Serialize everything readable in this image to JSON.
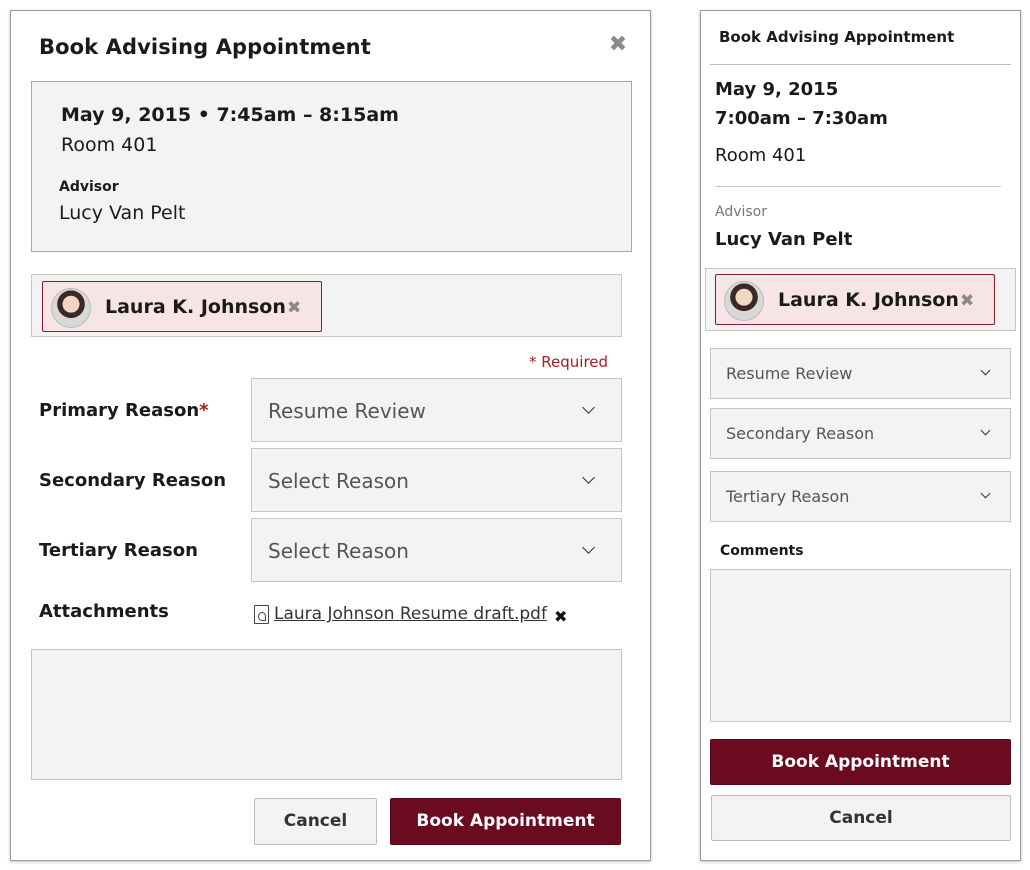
{
  "desktop": {
    "title": "Book Advising Appointment",
    "close_glyph": "✖",
    "appointment": {
      "datetime": "May 9, 2015 • 7:45am – 8:15am",
      "room": "Room 401",
      "advisor_label": "Advisor",
      "advisor_name": "Lucy Van Pelt"
    },
    "attendee": {
      "name": "Laura K. Johnson",
      "remove_glyph": "✖"
    },
    "required_note": "* Required",
    "reasons": [
      {
        "label": "Primary Reason",
        "required_mark": "*",
        "value": "Resume Review"
      },
      {
        "label": "Secondary Reason",
        "value": "Select Reason"
      },
      {
        "label": "Tertiary Reason",
        "value": "Select Reason"
      }
    ],
    "attachments": {
      "label": "Attachments",
      "filename": "Laura Johnson Resume draft.pdf",
      "remove_glyph": "✖"
    },
    "buttons": {
      "cancel": "Cancel",
      "book": "Book Appointment"
    }
  },
  "mobile": {
    "title": "Book Advising Appointment",
    "appointment": {
      "date": "May 9, 2015",
      "time": "7:00am – 7:30am",
      "room": "Room 401",
      "advisor_label": "Advisor",
      "advisor_name": "Lucy Van Pelt"
    },
    "attendee": {
      "name": "Laura K. Johnson",
      "remove_glyph": "✖"
    },
    "reasons": [
      "Resume Review",
      "Secondary Reason",
      "Tertiary Reason"
    ],
    "comments_label": "Comments",
    "buttons": {
      "book": "Book Appointment",
      "cancel": "Cancel"
    }
  },
  "colors": {
    "brand": "#6b0b1f",
    "required": "#a61d24",
    "chip_bg": "#f6e4e6",
    "field_bg": "#f3f3f3"
  },
  "icons": [
    "close-icon",
    "avatar",
    "remove-icon",
    "chevron-down-icon",
    "pdf-file-icon"
  ]
}
